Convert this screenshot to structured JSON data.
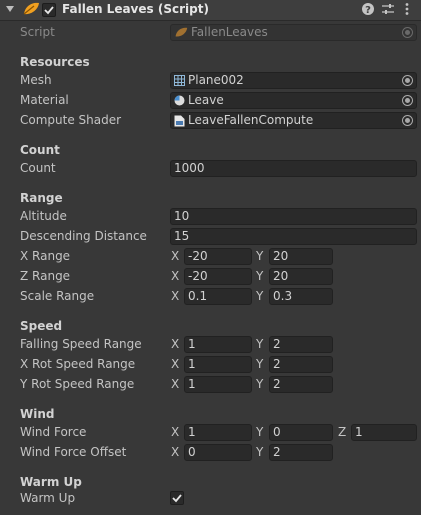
{
  "component": {
    "title": "Fallen Leaves (Script)",
    "enabled": true,
    "icons": [
      "help-icon",
      "presets-icon",
      "context-menu-icon"
    ]
  },
  "script": {
    "label": "Script",
    "value": "FallenLeaves"
  },
  "resources": {
    "header": "Resources",
    "mesh": {
      "label": "Mesh",
      "value": "Plane002",
      "icon": "mesh-icon"
    },
    "material": {
      "label": "Material",
      "value": "Leave",
      "icon": "material-icon"
    },
    "compute_shader": {
      "label": "Compute Shader",
      "value": "LeaveFallenCompute",
      "icon": "compute-shader-icon"
    }
  },
  "count": {
    "header": "Count",
    "count": {
      "label": "Count",
      "value": "1000"
    }
  },
  "range": {
    "header": "Range",
    "altitude": {
      "label": "Altitude",
      "value": "10"
    },
    "descending_distance": {
      "label": "Descending Distance",
      "value": "15"
    },
    "x_range": {
      "label": "X Range",
      "x": "-20",
      "y": "20"
    },
    "z_range": {
      "label": "Z Range",
      "x": "-20",
      "y": "20"
    },
    "scale_range": {
      "label": "Scale Range",
      "x": "0.1",
      "y": "0.3"
    }
  },
  "speed": {
    "header": "Speed",
    "falling": {
      "label": "Falling Speed Range",
      "x": "1",
      "y": "2"
    },
    "x_rot": {
      "label": "X Rot Speed Range",
      "x": "1",
      "y": "2"
    },
    "y_rot": {
      "label": "Y Rot Speed Range",
      "x": "1",
      "y": "2"
    }
  },
  "wind": {
    "header": "Wind",
    "force": {
      "label": "Wind Force",
      "x": "1",
      "y": "0",
      "z": "1"
    },
    "offset": {
      "label": "Wind Force Offset",
      "x": "0",
      "y": "2"
    }
  },
  "warm_up": {
    "header": "Warm Up",
    "toggle": {
      "label": "Warm Up",
      "checked": true,
      "mark": "✓"
    }
  },
  "axes": {
    "x": "X",
    "y": "Y",
    "z": "Z"
  },
  "colors": {
    "background": "#383838",
    "field": "#2a2a2a",
    "leaf_icon": "#f0a020"
  }
}
